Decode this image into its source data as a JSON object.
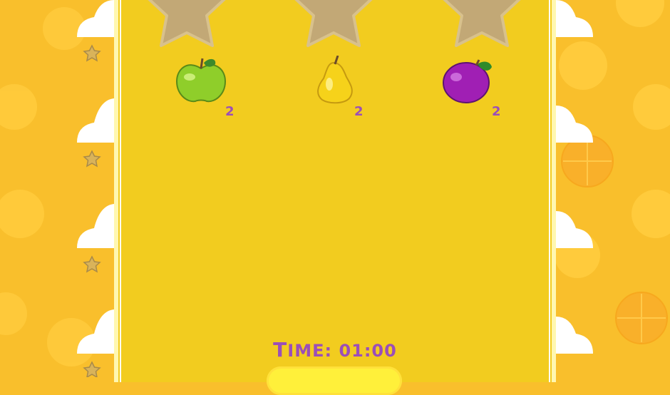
{
  "game": {
    "stars": [
      {
        "name": "star-1",
        "state": "empty"
      },
      {
        "name": "star-2",
        "state": "empty"
      },
      {
        "name": "star-3",
        "state": "empty"
      }
    ],
    "goals": [
      {
        "fruit": "apple",
        "count": "2"
      },
      {
        "fruit": "pear",
        "count": "2"
      },
      {
        "fruit": "plum",
        "count": "2"
      }
    ],
    "timer": {
      "label_first": "T",
      "label_rest": "IME: ",
      "value": "01:00"
    }
  },
  "colors": {
    "background": "#f9bf2c",
    "panel": "#f2cc1f",
    "text_accent": "#9b4fb8",
    "star_empty": "#c2a876"
  }
}
